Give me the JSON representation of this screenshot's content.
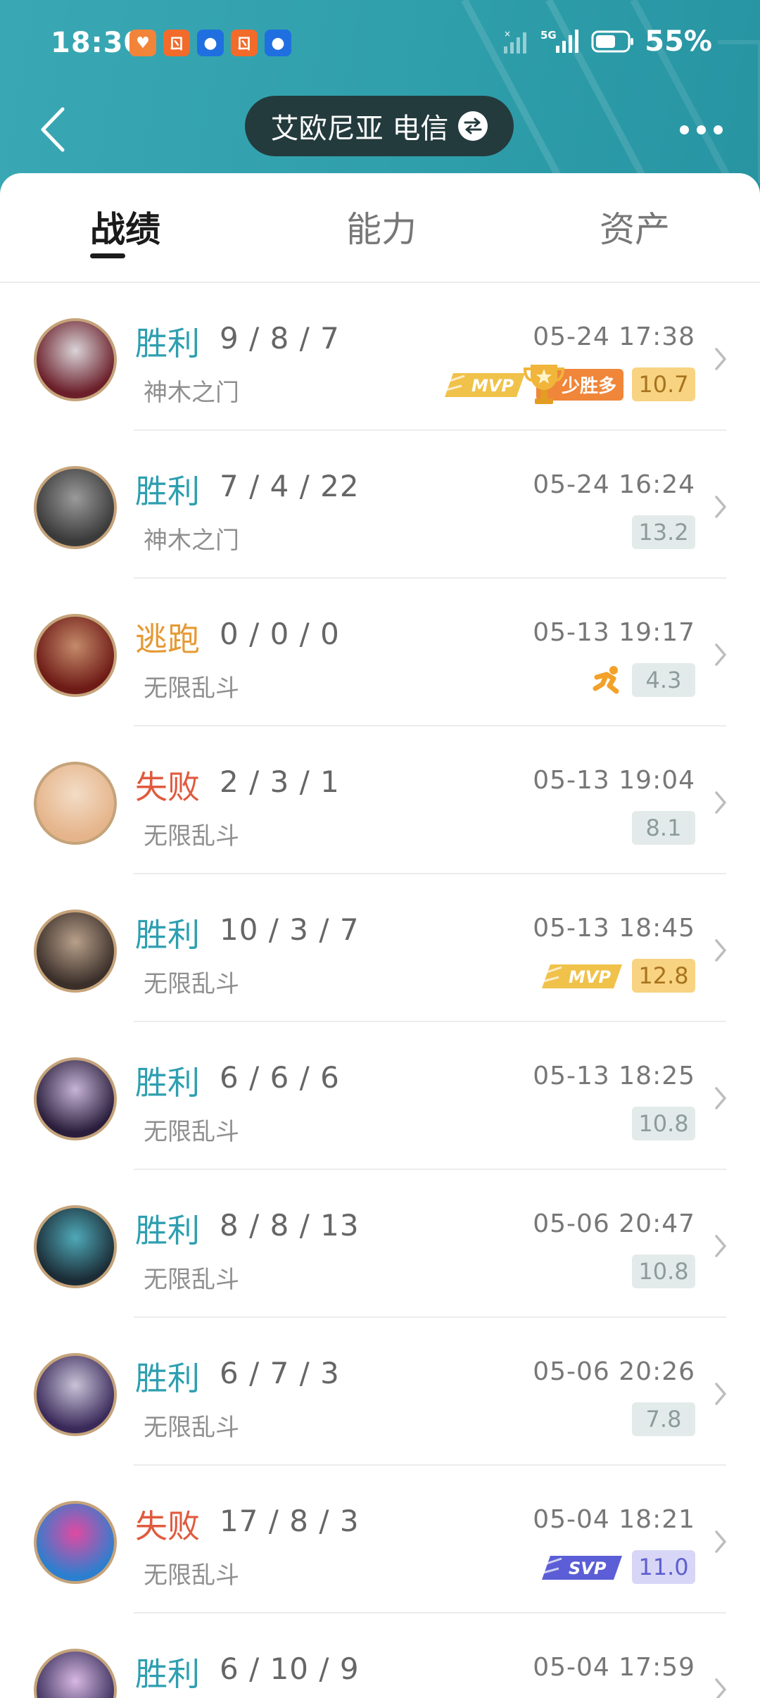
{
  "status_bar": {
    "time": "18:30",
    "battery": "55%",
    "network": "5G",
    "app_icons": [
      {
        "name": "heart-app-icon",
        "glyph": "♥",
        "color": "#f2843a"
      },
      {
        "name": "cat-app-icon",
        "glyph": "ㄖ",
        "color": "#f26b2a"
      },
      {
        "name": "circle-app-icon",
        "glyph": "●",
        "color": "#1f6fe0"
      },
      {
        "name": "cat-app-icon-2",
        "glyph": "ㄖ",
        "color": "#f26b2a"
      },
      {
        "name": "circle-app-icon-2",
        "glyph": "●",
        "color": "#1f6fe0"
      }
    ]
  },
  "nav": {
    "server_name": "艾欧尼亚 电信"
  },
  "tabs": [
    {
      "label": "战绩",
      "active": true
    },
    {
      "label": "能力",
      "active": false
    },
    {
      "label": "资产",
      "active": false
    }
  ],
  "matches": [
    {
      "result": "胜利",
      "result_type": "win",
      "kda": "9 / 8 / 7",
      "time": "05-24 17:38",
      "mode": "神木之门",
      "score": "10.7",
      "score_style": "gold",
      "badges": [
        "mvp",
        "trophy"
      ],
      "trophy_text": "少胜多",
      "avatar_colors": [
        "#6b1f2a",
        "#d9d4d8"
      ]
    },
    {
      "result": "胜利",
      "result_type": "win",
      "kda": "7 / 4 / 22",
      "time": "05-24 16:24",
      "mode": "神木之门",
      "score": "13.2",
      "score_style": "gray",
      "badges": [],
      "avatar_colors": [
        "#3a3a3a",
        "#9a9a9a"
      ]
    },
    {
      "result": "逃跑",
      "result_type": "flee",
      "kda": "0 / 0 / 0",
      "time": "05-13 19:17",
      "mode": "无限乱斗",
      "score": "4.3",
      "score_style": "gray",
      "badges": [
        "flee"
      ],
      "avatar_colors": [
        "#6e1a16",
        "#c48a6a"
      ]
    },
    {
      "result": "失败",
      "result_type": "lose",
      "kda": "2 / 3 / 1",
      "time": "05-13 19:04",
      "mode": "无限乱斗",
      "score": "8.1",
      "score_style": "gray",
      "badges": [],
      "avatar_colors": [
        "#e5b48a",
        "#f3dcc6"
      ]
    },
    {
      "result": "胜利",
      "result_type": "win",
      "kda": "10 / 3 / 7",
      "time": "05-13 18:45",
      "mode": "无限乱斗",
      "score": "12.8",
      "score_style": "gold",
      "badges": [
        "mvp"
      ],
      "avatar_colors": [
        "#3b2f2a",
        "#b8a08a"
      ]
    },
    {
      "result": "胜利",
      "result_type": "win",
      "kda": "6 / 6 / 6",
      "time": "05-13 18:25",
      "mode": "无限乱斗",
      "score": "10.8",
      "score_style": "gray",
      "badges": [],
      "avatar_colors": [
        "#2a1e3c",
        "#c7b4d6"
      ]
    },
    {
      "result": "胜利",
      "result_type": "win",
      "kda": "8 / 8 / 13",
      "time": "05-06 20:47",
      "mode": "无限乱斗",
      "score": "10.8",
      "score_style": "gray",
      "badges": [],
      "avatar_colors": [
        "#1b2c36",
        "#4fa9b8"
      ]
    },
    {
      "result": "胜利",
      "result_type": "win",
      "kda": "6 / 7 / 3",
      "time": "05-06 20:26",
      "mode": "无限乱斗",
      "score": "7.8",
      "score_style": "gray",
      "badges": [],
      "avatar_colors": [
        "#3a2a5a",
        "#c9c3d8"
      ]
    },
    {
      "result": "失败",
      "result_type": "lose",
      "kda": "17 / 8 / 3",
      "time": "05-04 18:21",
      "mode": "无限乱斗",
      "score": "11.0",
      "score_style": "purple",
      "badges": [
        "svp"
      ],
      "avatar_colors": [
        "#2c7fcf",
        "#e04aa2"
      ]
    },
    {
      "result": "胜利",
      "result_type": "win",
      "kda": "6 / 10 / 9",
      "time": "05-04 17:59",
      "mode": "",
      "score": "",
      "score_style": "gray",
      "badges": [],
      "avatar_colors": [
        "#3a2f5c",
        "#d7b8e2"
      ]
    }
  ],
  "badge_labels": {
    "mvp": "MVP",
    "svp": "SVP"
  },
  "colors": {
    "accent": "#2e9fb0",
    "lose": "#e05a3e",
    "flee": "#e59a34",
    "header_bg": "#2f9fab"
  }
}
